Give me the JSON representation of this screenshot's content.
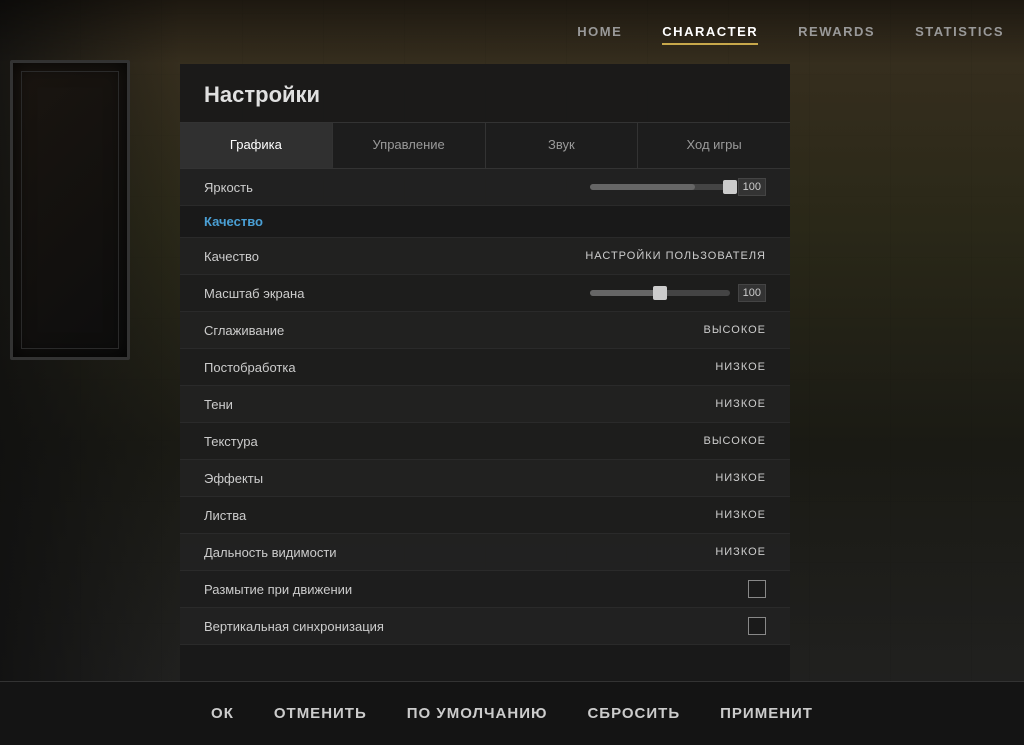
{
  "nav": {
    "items": [
      {
        "id": "home",
        "label": "HOME",
        "active": false
      },
      {
        "id": "character",
        "label": "CHARACTER",
        "active": false
      },
      {
        "id": "rewards",
        "label": "REWARDS",
        "active": false
      },
      {
        "id": "statistics",
        "label": "STATISTICS",
        "active": false
      }
    ]
  },
  "panel": {
    "title": "Настройки",
    "tabs": [
      {
        "id": "graphics",
        "label": "Графика",
        "active": true
      },
      {
        "id": "controls",
        "label": "Управление",
        "active": false
      },
      {
        "id": "sound",
        "label": "Звук",
        "active": false
      },
      {
        "id": "gameplay",
        "label": "Ход игры",
        "active": false
      }
    ],
    "brightness": {
      "label": "Яркость",
      "value": 100,
      "fill_percent": 75
    },
    "quality_section": "Качество",
    "settings": [
      {
        "id": "quality",
        "label": "Качество",
        "value": "НАСТРОЙКИ ПОЛЬЗОВАТЕЛЯ",
        "type": "text"
      },
      {
        "id": "scale",
        "label": "Масштаб экрана",
        "value": 100,
        "type": "slider",
        "fill_percent": 50
      },
      {
        "id": "antialiasing",
        "label": "Сглаживание",
        "value": "ВЫСОКОЕ",
        "type": "text"
      },
      {
        "id": "postprocess",
        "label": "Постобработка",
        "value": "НИЗКОЕ",
        "type": "text"
      },
      {
        "id": "shadows",
        "label": "Тени",
        "value": "НИЗКОЕ",
        "type": "text"
      },
      {
        "id": "texture",
        "label": "Текстура",
        "value": "ВЫСОКОЕ",
        "type": "text"
      },
      {
        "id": "effects",
        "label": "Эффекты",
        "value": "НИЗКОЕ",
        "type": "text"
      },
      {
        "id": "foliage",
        "label": "Листва",
        "value": "НИЗКОЕ",
        "type": "text"
      },
      {
        "id": "viewdist",
        "label": "Дальность видимости",
        "value": "НИЗКОЕ",
        "type": "text"
      },
      {
        "id": "motionblur",
        "label": "Размытие при движении",
        "value": "",
        "type": "checkbox",
        "checked": false
      },
      {
        "id": "vsync",
        "label": "Вертикальная синхронизация",
        "value": "",
        "type": "checkbox",
        "checked": false
      }
    ],
    "actions": [
      {
        "id": "ok",
        "label": "ОК"
      },
      {
        "id": "cancel",
        "label": "ОТМЕНИТЬ"
      },
      {
        "id": "default",
        "label": "ПО УМОЛЧАНИЮ"
      },
      {
        "id": "reset",
        "label": "СБРОСИТЬ"
      },
      {
        "id": "apply",
        "label": "ПРИМЕНИТ"
      }
    ]
  }
}
